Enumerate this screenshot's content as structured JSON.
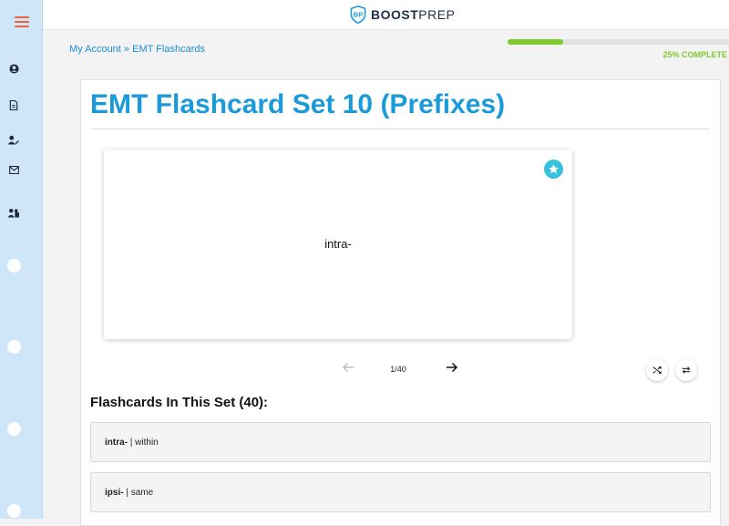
{
  "app": {
    "logo_boost": "BOOST",
    "logo_prep": "PREP",
    "colors": {
      "accent": "#1b9ad9",
      "progress": "#7dcb2b",
      "sidebar": "#cfe6f8",
      "star": "#36c2da",
      "menu": "#e8623d"
    }
  },
  "sidebar": {
    "icons": [
      "user-circle-icon",
      "document-icon",
      "user-edit-icon",
      "envelope-icon",
      "users-icon"
    ],
    "dots": 4
  },
  "breadcrumb": {
    "home": "My Account",
    "separator": "»",
    "current": "EMT Flashcards"
  },
  "progress": {
    "fraction": 0.25,
    "label": "25% COMPLETE"
  },
  "page": {
    "title": "EMT Flashcard Set 10 (Prefixes)"
  },
  "card": {
    "front_text": "intra-",
    "counter": "1/40"
  },
  "set": {
    "heading": "Flashcards In This Set (40):",
    "separator": "|",
    "items": [
      {
        "term": "intra-",
        "definition": "within"
      },
      {
        "term": "ipsi-",
        "definition": "same"
      }
    ]
  }
}
